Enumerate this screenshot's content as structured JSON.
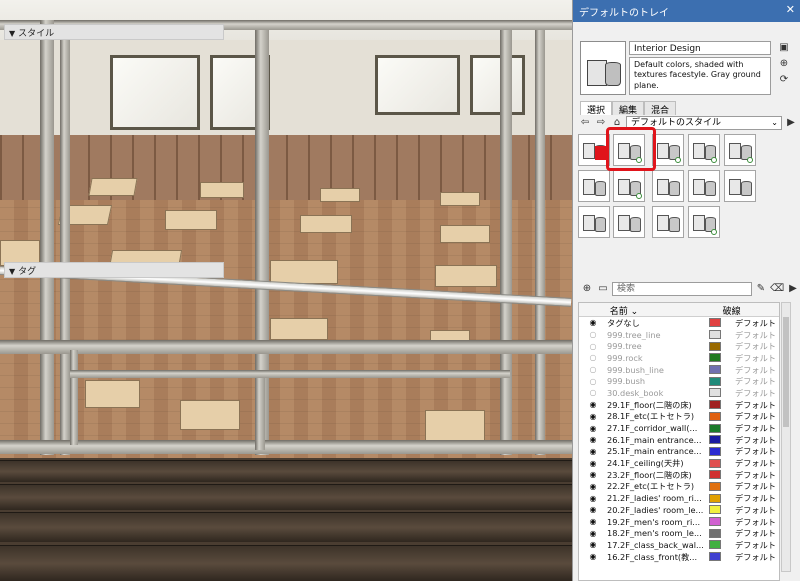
{
  "tray": {
    "title": "デフォルトのトレイ",
    "close_glyph": "✕"
  },
  "styles_panel": {
    "header": "スタイル",
    "style_name": "Interior Design",
    "style_description": "Default colors, shaded with textures facestyle. Gray ground plane.",
    "tabs": [
      "選択",
      "編集",
      "混合"
    ],
    "collection": "デフォルトのスタイル"
  },
  "tags_panel": {
    "header": "タグ",
    "search_placeholder": "検索",
    "col_name": "名前",
    "col_linetype": "破線",
    "rows": [
      {
        "name": "タグなし",
        "color": "#e04040",
        "linetype": "デフォルト",
        "visible": true
      },
      {
        "name": "999.tree_line",
        "color": "#e0e0e0",
        "linetype": "デフォルト",
        "visible": false
      },
      {
        "name": "999.tree",
        "color": "#9a6a00",
        "linetype": "デフォルト",
        "visible": false
      },
      {
        "name": "999.rock",
        "color": "#1f7a1f",
        "linetype": "デフォルト",
        "visible": false
      },
      {
        "name": "999.bush_line",
        "color": "#7070b0",
        "linetype": "デフォルト",
        "visible": false
      },
      {
        "name": "999.bush",
        "color": "#1f8a7a",
        "linetype": "デフォルト",
        "visible": false
      },
      {
        "name": "30.desk_book",
        "color": "#e0e0e0",
        "linetype": "デフォルト",
        "visible": false
      },
      {
        "name": "29.1F_floor(二階の床)",
        "color": "#a02020",
        "linetype": "デフォルト",
        "visible": true
      },
      {
        "name": "28.1F_etc(エトセトラ)",
        "color": "#e06010",
        "linetype": "デフォルト",
        "visible": true
      },
      {
        "name": "27.1F_corridor_wall(...",
        "color": "#1a7a2a",
        "linetype": "デフォルト",
        "visible": true
      },
      {
        "name": "26.1F_main entrance...",
        "color": "#1a1aa0",
        "linetype": "デフォルト",
        "visible": true
      },
      {
        "name": "25.1F_main entrance...",
        "color": "#2a2ad0",
        "linetype": "デフォルト",
        "visible": true
      },
      {
        "name": "24.1F_ceiling(天井)",
        "color": "#e05050",
        "linetype": "デフォルト",
        "visible": true
      },
      {
        "name": "23.2F_floor(二階の床)",
        "color": "#d03030",
        "linetype": "デフォルト",
        "visible": true
      },
      {
        "name": "22.2F_etc(エトセトラ)",
        "color": "#e07010",
        "linetype": "デフォルト",
        "visible": true
      },
      {
        "name": "21.2F_ladies' room_ri...",
        "color": "#e0a000",
        "linetype": "デフォルト",
        "visible": true
      },
      {
        "name": "20.2F_ladies' room_le...",
        "color": "#f0f040",
        "linetype": "デフォルト",
        "visible": true
      },
      {
        "name": "19.2F_men's room_ri...",
        "color": "#d060d0",
        "linetype": "デフォルト",
        "visible": true
      },
      {
        "name": "18.2F_men's room_le...",
        "color": "#707070",
        "linetype": "デフォルト",
        "visible": true
      },
      {
        "name": "17.2F_class_back_wal...",
        "color": "#40b040",
        "linetype": "デフォルト",
        "visible": true
      },
      {
        "name": "16.2F_class_front(教...",
        "color": "#4040d0",
        "linetype": "デフォルト",
        "visible": true
      }
    ]
  },
  "icons": {
    "eye": "◉",
    "eye_off": "○",
    "add": "⊕",
    "folder": "▭",
    "pencil": "✎",
    "eraser": "⌫",
    "details": "▶",
    "back": "⇦",
    "forward": "⇨",
    "home": "⌂",
    "refresh": "⟳",
    "save": "▣",
    "collapse": "▼",
    "sort": "⌄"
  }
}
